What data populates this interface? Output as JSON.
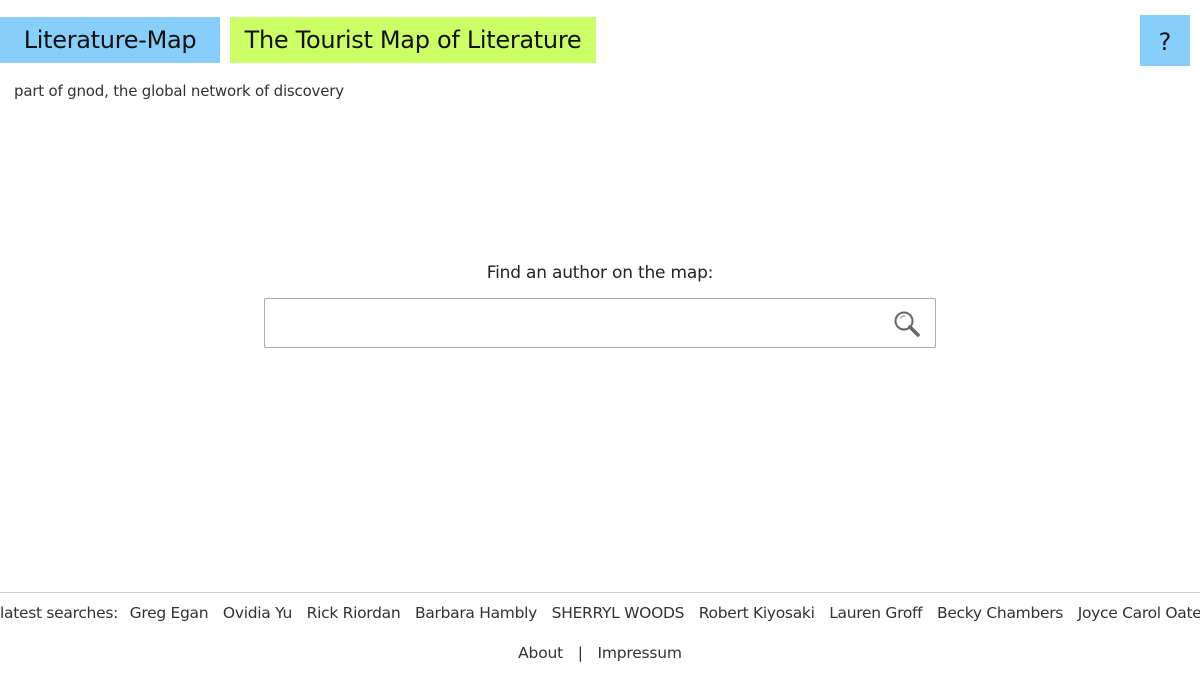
{
  "header": {
    "brand": "Literature-Map",
    "tagline": "The Tourist Map of Literature",
    "help_label": "?",
    "subtitle": "part of gnod, the global network of discovery"
  },
  "search": {
    "label": "Find an author on the map:",
    "value": "",
    "placeholder": "",
    "icon": "search-icon"
  },
  "footer": {
    "latest_label": "latest searches:",
    "latest_searches": [
      "Greg Egan",
      "Ovidia Yu",
      "Rick Riordan",
      "Barbara Hambly",
      "SHERRYL WOODS",
      "Robert Kiyosaki",
      "Lauren Groff",
      "Becky Chambers",
      "Joyce Carol Oates"
    ],
    "links": {
      "about": "About",
      "separator": "|",
      "impressum": "Impressum"
    }
  },
  "colors": {
    "brand_bg": "#87cefa",
    "tagline_bg": "#ccff66",
    "help_bg": "#87cefa"
  }
}
